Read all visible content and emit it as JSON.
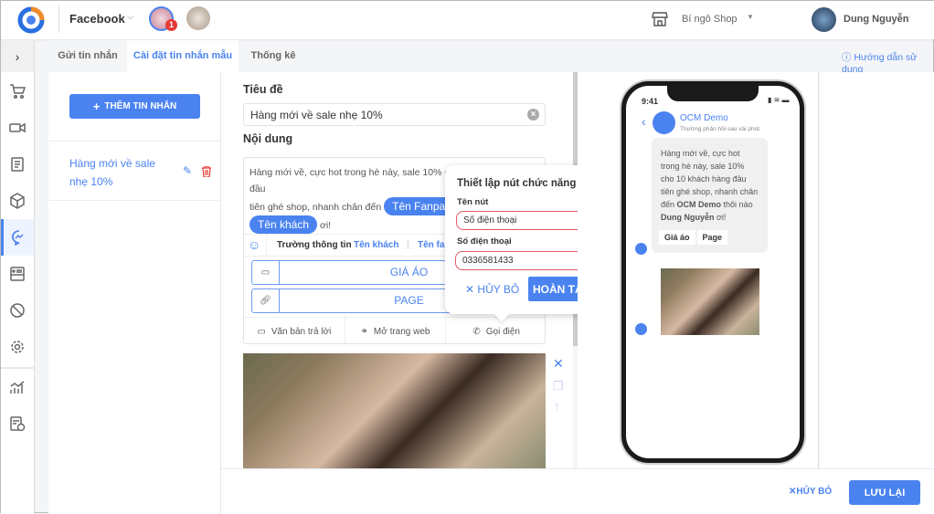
{
  "header": {
    "channel": "Facebook",
    "badge_count": "1",
    "shop": "Bí ngô Shop",
    "user": "Dung Nguyễn"
  },
  "tabs": [
    {
      "label": "Gửi tin nhắn"
    },
    {
      "label": "Cài đặt tin nhắn mẫu",
      "active": true
    },
    {
      "label": "Thống kê"
    }
  ],
  "help_link": "Hướng dẫn sử dụng",
  "sidebar_icons": [
    "cart-icon",
    "video-icon",
    "document-icon",
    "box-icon",
    "messenger-icon",
    "card-icon",
    "block-icon",
    "gear-icon",
    "chart-icon",
    "schedule-icon"
  ],
  "templates": {
    "add_label": "THÊM TIN NHẮN",
    "items": [
      {
        "title": "Hàng mới về sale nhẹ 10%"
      }
    ]
  },
  "editor": {
    "title_label": "Tiêu đề",
    "title_value": "Hàng mới về sale nhẹ 10%",
    "content_label": "Nội dung",
    "content_text_1": "Hàng mới về, cực hot trong hè này, sale 10% cho 10 khách hàng đầu",
    "content_text_2": "tiên ghé shop, nhanh chân đến",
    "chip_fanpage": "Tên Fanpage",
    "chip_customer": "Tên khách",
    "content_end": "ơi!",
    "fields_label": "Trường thông tin",
    "field_customer": "Tên khách",
    "field_fanpage": "Tên fanpage",
    "buttons": [
      {
        "label": "GIÁ ÁO"
      },
      {
        "label": "PAGE"
      }
    ],
    "add_types": [
      {
        "label": "Văn bản trả lời"
      },
      {
        "label": "Mở trang web"
      },
      {
        "label": "Gọi điện"
      }
    ]
  },
  "popup": {
    "title": "Thiết lập nút chức năng",
    "name_label": "Tên nút",
    "name_value": "Số điện thoại",
    "phone_label": "Số điện thoại",
    "phone_value": "0336581433",
    "cancel": "HỦY BỎ",
    "done": "HOÀN TẤT"
  },
  "preview": {
    "time": "9:41",
    "page_name": "OCM Demo",
    "status": "Thường phản hồi sau vài phút",
    "msg_1": "Hàng mới về, cực hot trong hè này, sale 10% cho 10 khách hàng đầu tiên ghé shop, nhanh chân đến ",
    "msg_page": "OCM Demo",
    "msg_2": " thôi nào ",
    "msg_user": "Dung Nguyễn",
    "msg_3": " ơi!",
    "buttons": [
      "Giá áo",
      "Page"
    ]
  },
  "footer": {
    "cancel": "HỦY BỎ",
    "save": "LƯU LẠI"
  },
  "colors": {
    "accent": "#4a83f0",
    "danger": "#e53935"
  }
}
